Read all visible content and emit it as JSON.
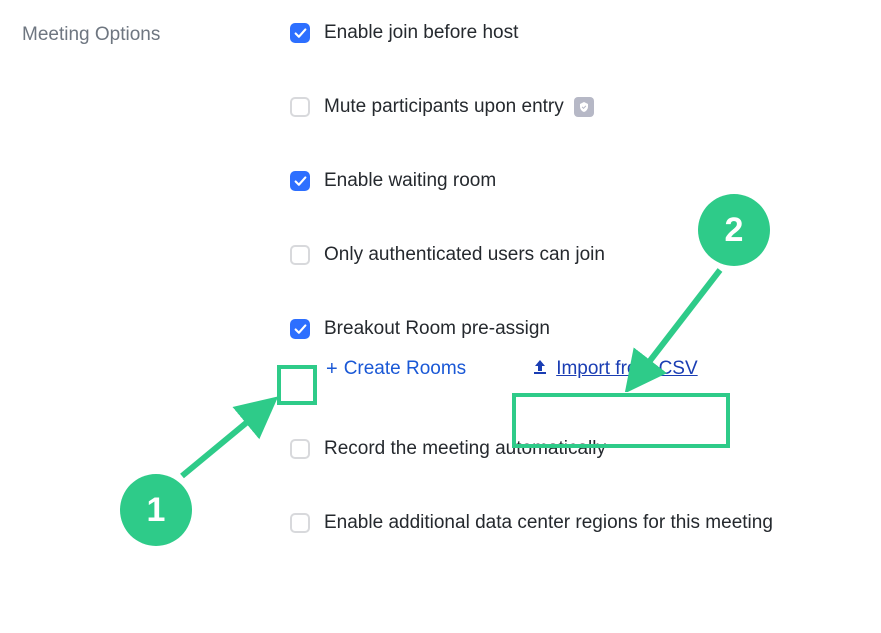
{
  "section_label": "Meeting Options",
  "options": {
    "enable_join_before_host": {
      "label": "Enable join before host",
      "checked": true
    },
    "mute_participants": {
      "label": "Mute participants upon entry",
      "checked": false,
      "locked": true
    },
    "enable_waiting_room": {
      "label": "Enable waiting room",
      "checked": true
    },
    "only_authenticated": {
      "label": "Only authenticated users can join",
      "checked": false
    },
    "breakout_preassign": {
      "label": "Breakout Room pre-assign",
      "checked": true
    },
    "record_auto": {
      "label": "Record the meeting automatically",
      "checked": false
    },
    "additional_dc": {
      "label": "Enable additional data center regions for this meeting",
      "checked": false
    }
  },
  "breakout_actions": {
    "create_rooms": "Create Rooms",
    "import_csv": "Import from CSV"
  },
  "callouts": {
    "one": "1",
    "two": "2"
  },
  "colors": {
    "accent_blue": "#2D6FFF",
    "link_blue": "#1a58d6",
    "highlight_green": "#2ecb89",
    "text_dark": "#25292e",
    "text_muted": "#6e7680"
  }
}
